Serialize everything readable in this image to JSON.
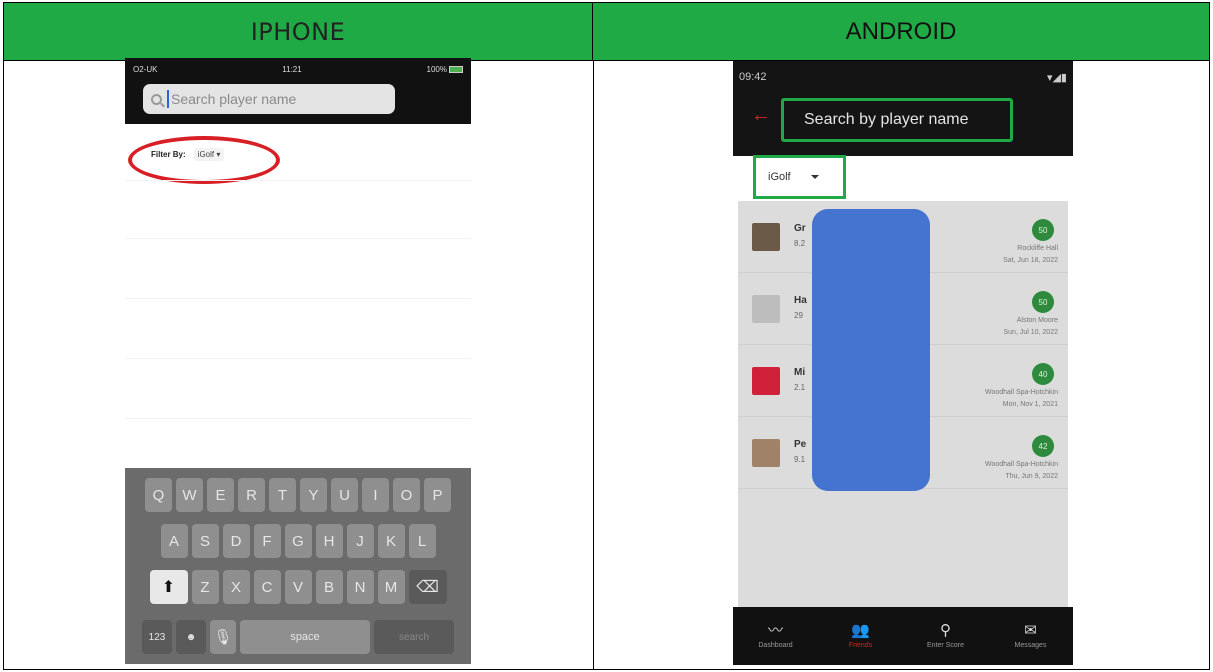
{
  "header": {
    "left_title": "IPHONE",
    "right_title": "ANDROID"
  },
  "iphone": {
    "status": {
      "carrier": "O2-UK",
      "time": "11:21",
      "battery": "100%"
    },
    "search_placeholder": "Search player name",
    "filter_label": "Filter By:",
    "filter_value": "iGolf",
    "keyboard": {
      "row1": [
        "Q",
        "W",
        "E",
        "R",
        "T",
        "Y",
        "U",
        "I",
        "O",
        "P"
      ],
      "row2": [
        "A",
        "S",
        "D",
        "F",
        "G",
        "H",
        "J",
        "K",
        "L"
      ],
      "row3": [
        "Z",
        "X",
        "C",
        "V",
        "B",
        "N",
        "M"
      ],
      "numbers_key": "123",
      "space_key": "space",
      "return_key": "search"
    },
    "accent_color": "#d91f26"
  },
  "android": {
    "status": {
      "time": "09:42"
    },
    "search_placeholder": "Search by player name",
    "filter_value": "iGolf",
    "rows": [
      {
        "name": "Gr",
        "sub": "8.2",
        "badge": "50",
        "course": "Rockliffe Hall",
        "date": "Sat, Jun 18, 2022",
        "avatar_color": "#6b5a48"
      },
      {
        "name": "Ha",
        "sub": "29",
        "badge": "50",
        "course": "Alston Moore",
        "date": "Sun, Jul 10, 2022",
        "avatar_color": "#bdbdbd"
      },
      {
        "name": "Mi",
        "sub": "2.1",
        "badge": "40",
        "course": "Woodhall Spa-Hotchkin",
        "date": "Mon, Nov 1, 2021",
        "avatar_color": "#d0213a"
      },
      {
        "name": "Pe",
        "sub": "9.1",
        "badge": "42",
        "course": "Woodhall Spa-Hotchkin",
        "date": "Thu, Jun 9, 2022",
        "avatar_color": "#a08268"
      }
    ],
    "nav": [
      {
        "label": "Dashboard",
        "icon": "chart-icon"
      },
      {
        "label": "Friends",
        "icon": "people-icon"
      },
      {
        "label": "Enter Score",
        "icon": "golf-pin-icon"
      },
      {
        "label": "Messages",
        "icon": "envelope-icon"
      }
    ],
    "highlight_color": "#1faa45",
    "redaction_color": "#4473d0"
  }
}
